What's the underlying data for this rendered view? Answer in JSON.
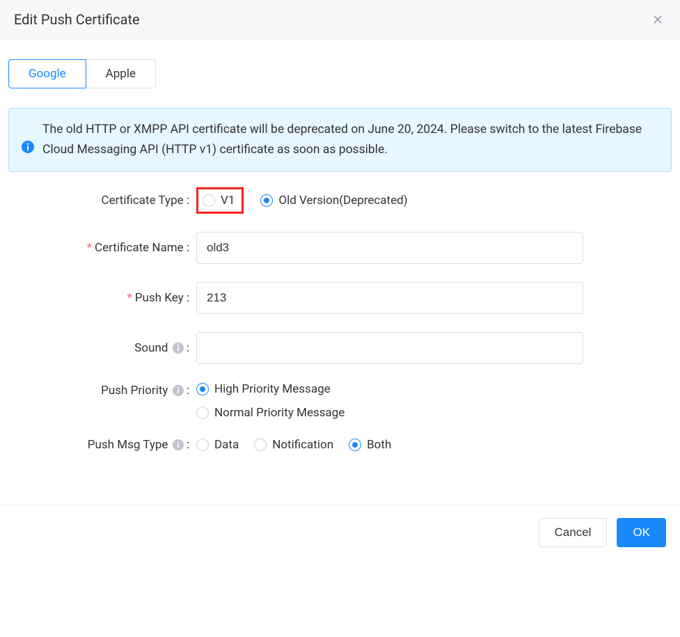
{
  "header": {
    "title": "Edit Push Certificate"
  },
  "tabs": {
    "google": "Google",
    "apple": "Apple"
  },
  "alert": {
    "text": "The old HTTP or XMPP API certificate will be deprecated on June 20, 2024. Please switch to the latest Firebase Cloud Messaging API (HTTP v1) certificate as soon as possible."
  },
  "form": {
    "cert_type": {
      "label": "Certificate Type :",
      "v1": "V1",
      "old": "Old Version(Deprecated)"
    },
    "cert_name": {
      "label": "Certificate Name :",
      "value": "old3"
    },
    "push_key": {
      "label": "Push Key :",
      "value": "213"
    },
    "sound": {
      "label": "Sound",
      "colon": ":",
      "value": ""
    },
    "push_priority": {
      "label": "Push Priority",
      "colon": ":",
      "high": "High Priority Message",
      "normal": "Normal Priority Message"
    },
    "push_msg_type": {
      "label": "Push Msg Type",
      "colon": ":",
      "data": "Data",
      "notification": "Notification",
      "both": "Both"
    }
  },
  "footer": {
    "cancel": "Cancel",
    "ok": "OK"
  }
}
